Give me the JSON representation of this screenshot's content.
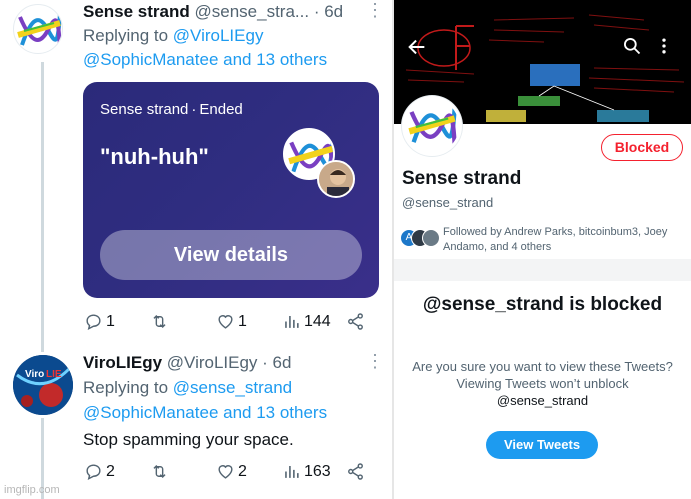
{
  "tweet1": {
    "name": "Sense strand",
    "handle": "@sense_stra...",
    "time": "· 6d",
    "replying_prefix": "Replying to",
    "replying_to": "@ViroLIEgy",
    "mentions": "@SophicManatee and 13 others",
    "poll": {
      "author": "Sense strand",
      "status": "Ended",
      "question": "\"nuh-huh\"",
      "button": "View details"
    },
    "actions": {
      "replies": "1",
      "retweets": "",
      "likes": "1",
      "views": "144"
    }
  },
  "tweet2": {
    "name": "ViroLIEgy",
    "handle": "@ViroLIEgy",
    "time": "· 6d",
    "replying_prefix": "Replying to",
    "replying_to": "@sense_strand",
    "mentions": "@SophicManatee and 13 others",
    "text": "Stop spamming your space.",
    "actions": {
      "replies": "2",
      "retweets": "",
      "likes": "2",
      "views": "163"
    }
  },
  "profile": {
    "name": "Sense strand",
    "handle": "@sense_strand",
    "blocked_button": "Blocked",
    "followed_by": "Followed by Andrew Parks, bitcoinbum3, Joey Andamo, and 4 others",
    "blocked_title": "@sense_strand is blocked",
    "blocked_body_prefix": "Are you sure you want to view these Tweets? Viewing Tweets won’t unblock",
    "blocked_body_handle": "@sense_strand",
    "view_tweets_button": "View Tweets"
  },
  "watermark": "imgflip.com",
  "colors": {
    "link": "#1d9bf0",
    "poll_bg": "#2f2d80",
    "blocked_red": "#f4212e",
    "secondary_text": "#536471"
  }
}
